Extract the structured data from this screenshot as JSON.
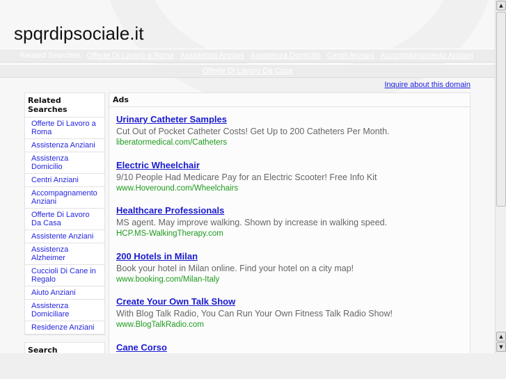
{
  "site_title": "spqrdipsociale.it",
  "nav": {
    "label": "Related Searches:",
    "links": [
      "Offerte Di Lavoro a Roma",
      "Assistenza Anziani",
      "Assistenza Domicilio",
      "Centri Anziani",
      "Accompagnamento Anziani",
      "Offerte Di Lavoro Da Casa"
    ]
  },
  "inquire": "Inquire about this domain",
  "sidebar": {
    "heading": "Related Searches",
    "items": [
      "Offerte Di Lavoro a Roma",
      "Assistenza Anziani",
      "Assistenza Domicilio",
      "Centri Anziani",
      "Accompagnamento Anziani",
      "Offerte Di Lavoro Da Casa",
      "Assistente Anziani",
      "Assistenza Alzheimer",
      "Cuccioli Di Cane in Regalo",
      "Aiuto Anziani",
      "Assistenza Domiciliare",
      "Residenze Anziani"
    ],
    "search_heading": "Search"
  },
  "ads": {
    "heading": "Ads",
    "items": [
      {
        "title": "Urinary Catheter Samples",
        "desc": "Cut Out of Pocket Catheter Costs! Get Up to 200 Catheters Per Month.",
        "url": "liberatormedical.com/Catheters"
      },
      {
        "title": "Electric Wheelchair",
        "desc": "9/10 People Had Medicare Pay for an Electric Scooter! Free Info Kit",
        "url": "www.Hoveround.com/Wheelchairs"
      },
      {
        "title": "Healthcare Professionals",
        "desc": "MS agent. May improve walking. Shown by increase in walking speed.",
        "url": "HCP.MS-WalkingTherapy.com"
      },
      {
        "title": "200 Hotels in Milan",
        "desc": "Book your hotel in Milan online. Find your hotel on a city map!",
        "url": "www.booking.com/Milan-Italy"
      },
      {
        "title": "Create Your Own Talk Show",
        "desc": "With Blog Talk Radio, You Can Run Your Own Fitness Talk Radio Show!",
        "url": "www.BlogTalkRadio.com"
      },
      {
        "title": "Cane Corso",
        "desc": "",
        "url": ""
      }
    ]
  },
  "scrollbar": {
    "up_icon": "▲",
    "down_icon": "▼"
  }
}
